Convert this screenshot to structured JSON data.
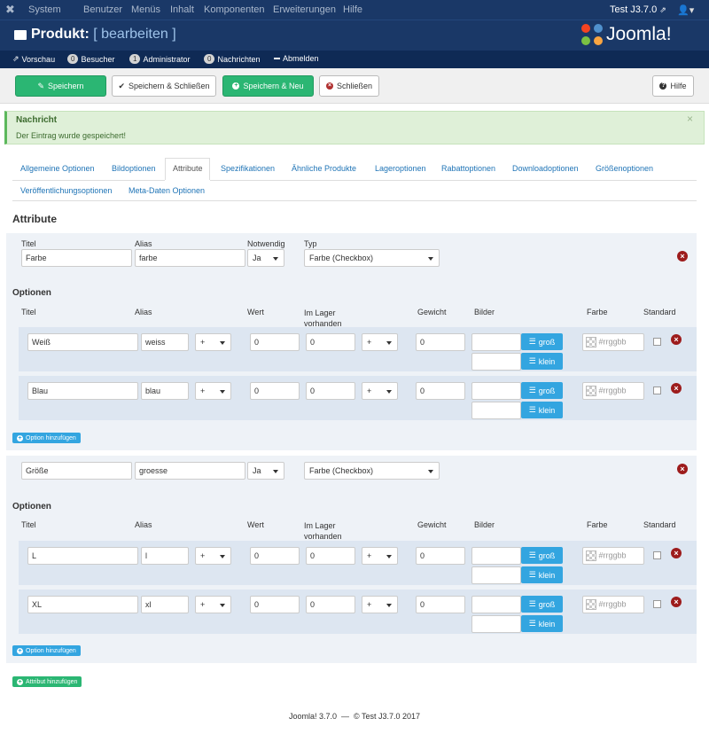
{
  "topnav": {
    "menu": [
      "System",
      "Benutzer",
      "Menüs",
      "Inhalt",
      "Komponenten",
      "Erweiterungen",
      "Hilfe"
    ],
    "site": "Test J3.7.0"
  },
  "header": {
    "title_prefix": "Produkt:",
    "title_action": "[ bearbeiten ]",
    "logo_text": "Joomla!"
  },
  "status": {
    "preview": "Vorschau",
    "visitors_count": "0",
    "visitors": "Besucher",
    "admin_count": "1",
    "admin": "Administrator",
    "messages_count": "0",
    "messages": "Nachrichten",
    "logout": "Abmelden"
  },
  "toolbar": {
    "save": "Speichern",
    "save_close": "Speichern & Schließen",
    "save_new": "Speichern & Neu",
    "close": "Schließen",
    "help": "Hilfe"
  },
  "message": {
    "title": "Nachricht",
    "text": "Der Eintrag wurde gespeichert!",
    "close": "×"
  },
  "tabs": [
    "Allgemeine Optionen",
    "Bildoptionen",
    "Attribute",
    "Spezifikationen",
    "Ähnliche Produkte",
    "Lageroptionen",
    "Rabattoptionen",
    "Downloadoptionen",
    "Größenoptionen",
    "Veröffentlichungsoptionen",
    "Meta-Daten Optionen"
  ],
  "section_title": "Attribute",
  "labels": {
    "title": "Titel",
    "alias": "Alias",
    "required": "Notwendig",
    "type": "Typ",
    "options": "Optionen",
    "value": "Wert",
    "stock_1": "Im Lager",
    "stock_2": "vorhanden",
    "weight": "Gewicht",
    "images": "Bilder",
    "color": "Farbe",
    "default": "Standard",
    "btn_large": "groß",
    "btn_small": "klein",
    "color_placeholder": "#rrggbb",
    "add_option": "Option hinzufügen",
    "add_attribute": "Attribut hinzufügen"
  },
  "attributes": [
    {
      "title": "Farbe",
      "alias": "farbe",
      "required": "Ja",
      "type": "Farbe (Checkbox)",
      "options": [
        {
          "title": "Weiß",
          "alias": "weiss",
          "op1": "+",
          "value": "0",
          "stock": "0",
          "op2": "+",
          "weight": "0"
        },
        {
          "title": "Blau",
          "alias": "blau",
          "op1": "+",
          "value": "0",
          "stock": "0",
          "op2": "+",
          "weight": "0"
        }
      ]
    },
    {
      "title": "Größe",
      "alias": "groesse",
      "required": "Ja",
      "type": "Farbe (Checkbox)",
      "options": [
        {
          "title": "L",
          "alias": "l",
          "op1": "+",
          "value": "0",
          "stock": "0",
          "op2": "+",
          "weight": "0"
        },
        {
          "title": "XL",
          "alias": "xl",
          "op1": "+",
          "value": "0",
          "stock": "0",
          "op2": "+",
          "weight": "0"
        }
      ]
    }
  ],
  "footer": "Joomla! 3.7.0  —  © Test J3.7.0 2017",
  "colors": {
    "nav": "#1a3867",
    "green": "#2bb673",
    "blue": "#33a5e0",
    "danger": "#9d1c1c"
  }
}
